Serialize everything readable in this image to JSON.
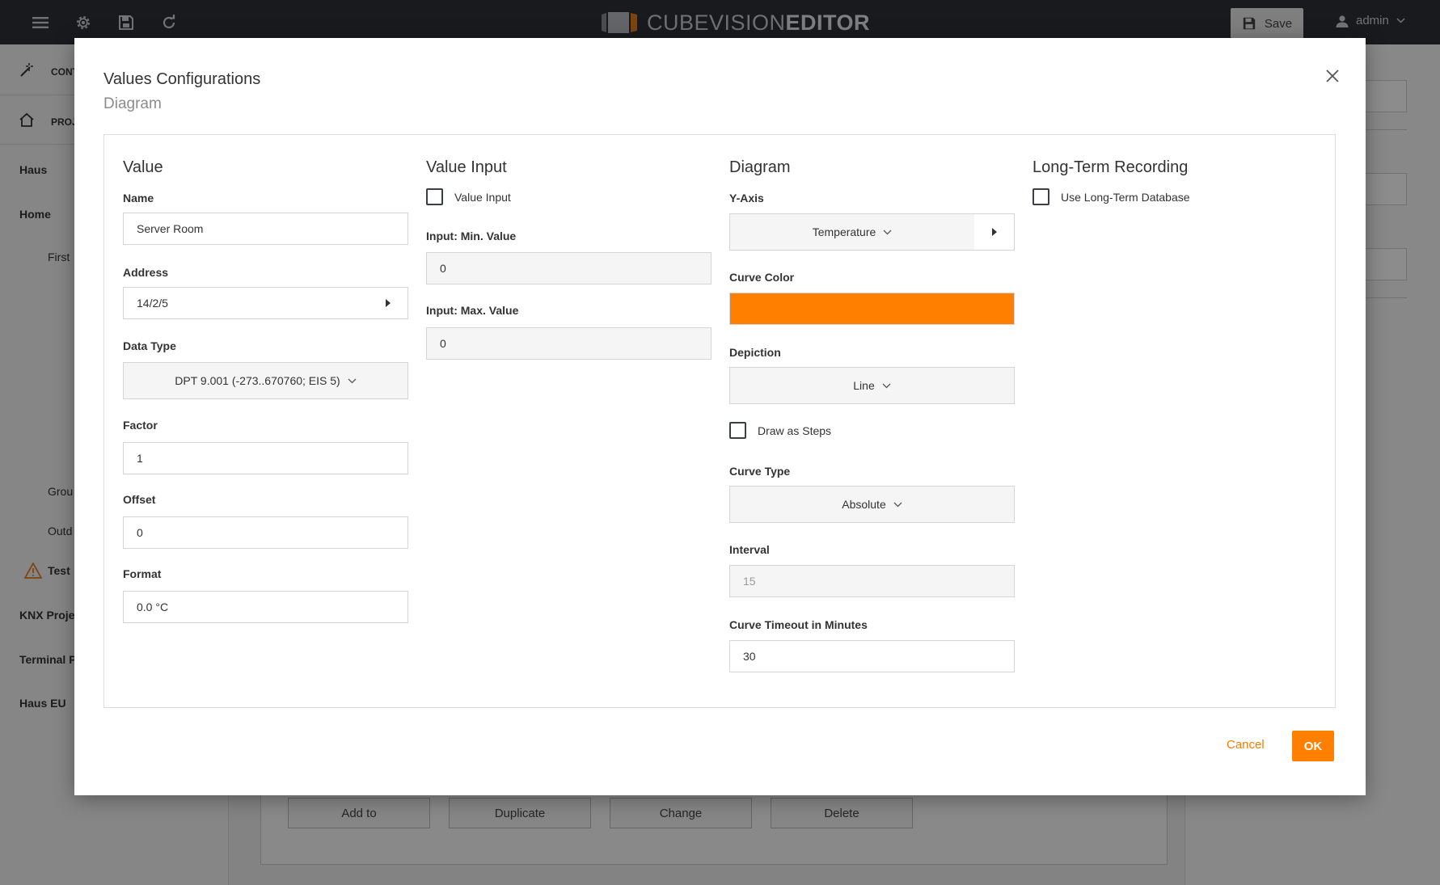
{
  "topbar": {
    "logo_light": "CUBEVISION",
    "logo_bold": "EDITOR",
    "save_label": "Save",
    "user_name": "admin",
    "icons": [
      "menu-icon",
      "gear-icon",
      "floppy-disk-icon",
      "refresh-icon"
    ]
  },
  "sidebar": {
    "items": [
      {
        "label": "CONT",
        "icon": "magic-wand-icon"
      },
      {
        "label": "PROJ",
        "icon": "home-icon"
      },
      {
        "label": "Haus"
      },
      {
        "label": "Home"
      },
      {
        "label": "First"
      },
      {
        "label": "Grou"
      },
      {
        "label": "Outd"
      },
      {
        "label": "Test",
        "icon": "warning-icon"
      },
      {
        "label": "KNX Proje"
      },
      {
        "label": "Terminal P"
      },
      {
        "label": "Haus EU"
      }
    ]
  },
  "background_buttons": {
    "add": "Add to",
    "duplicate": "Duplicate",
    "change": "Change",
    "delete": "Delete"
  },
  "modal": {
    "title": "Values Configurations",
    "subtitle": "Diagram",
    "value": {
      "title": "Value",
      "name_label": "Name",
      "name_value": "Server Room",
      "address_label": "Address",
      "address_value": "14/2/5",
      "datatype_label": "Data Type",
      "datatype_value": "DPT 9.001 (-273..670760; EIS 5)",
      "factor_label": "Factor",
      "factor_value": "1",
      "offset_label": "Offset",
      "offset_value": "0",
      "format_label": "Format",
      "format_value": "0.0 °C"
    },
    "value_input": {
      "title": "Value Input",
      "checkbox_label": "Value Input",
      "checked": false,
      "min_label": "Input: Min. Value",
      "min_value": "0",
      "max_label": "Input: Max. Value",
      "max_value": "0"
    },
    "diagram": {
      "title": "Diagram",
      "yaxis_label": "Y-Axis",
      "yaxis_value": "Temperature",
      "curve_color_label": "Curve Color",
      "curve_color": "#ff7f00",
      "depiction_label": "Depiction",
      "depiction_value": "Line",
      "steps_label": "Draw as Steps",
      "steps_checked": false,
      "curve_type_label": "Curve Type",
      "curve_type_value": "Absolute",
      "interval_label": "Interval",
      "interval_value": "15",
      "timeout_label": "Curve Timeout in Minutes",
      "timeout_value": "30"
    },
    "long_term": {
      "title": "Long-Term Recording",
      "checkbox_label": "Use Long-Term Database",
      "checked": false
    },
    "cancel_label": "Cancel",
    "ok_label": "OK"
  }
}
